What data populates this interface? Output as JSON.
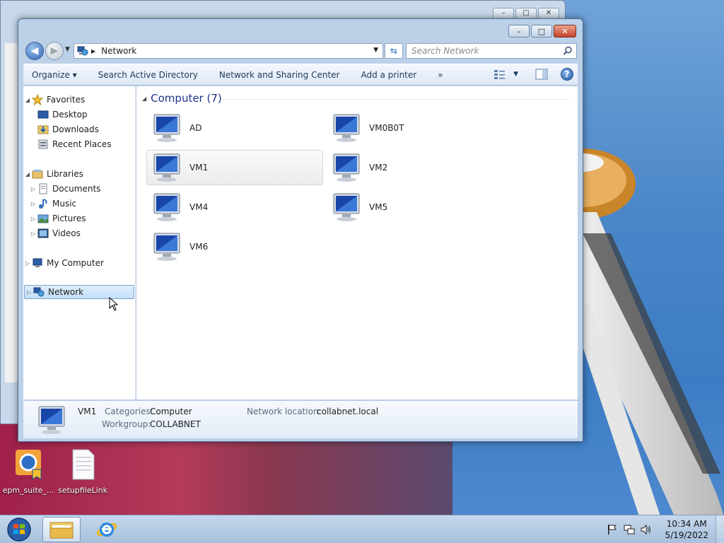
{
  "window": {
    "address": "Network",
    "search_placeholder": "Search Network",
    "controls": {
      "minimize": "–",
      "maximize": "□",
      "close": "✕"
    }
  },
  "toolbar": {
    "organize": "Organize",
    "search_ad": "Search Active Directory",
    "network_sharing": "Network and Sharing Center",
    "add_printer": "Add a printer",
    "more": "»"
  },
  "navpane": {
    "favorites": "Favorites",
    "desktop": "Desktop",
    "downloads": "Downloads",
    "recent_places": "Recent Places",
    "libraries": "Libraries",
    "documents": "Documents",
    "music": "Music",
    "pictures": "Pictures",
    "videos": "Videos",
    "my_computer": "My Computer",
    "network": "Network"
  },
  "content": {
    "group_title": "Computer (7)",
    "computers": [
      "AD",
      "VM0B0T",
      "VM1",
      "VM2",
      "VM4",
      "VM5",
      "VM6"
    ]
  },
  "details": {
    "name": "VM1",
    "categories_label": "Categories:",
    "categories_value": "Computer",
    "workgroup_label": "Workgroup:",
    "workgroup_value": "COLLABNET",
    "network_location_label": "Network location:",
    "network_location_value": "collabnet.local"
  },
  "desktop": {
    "icon1": "epm_suite_...",
    "icon2": "setupfileLink"
  },
  "taskbar": {
    "time": "10:34 AM",
    "date": "5/19/2022"
  }
}
